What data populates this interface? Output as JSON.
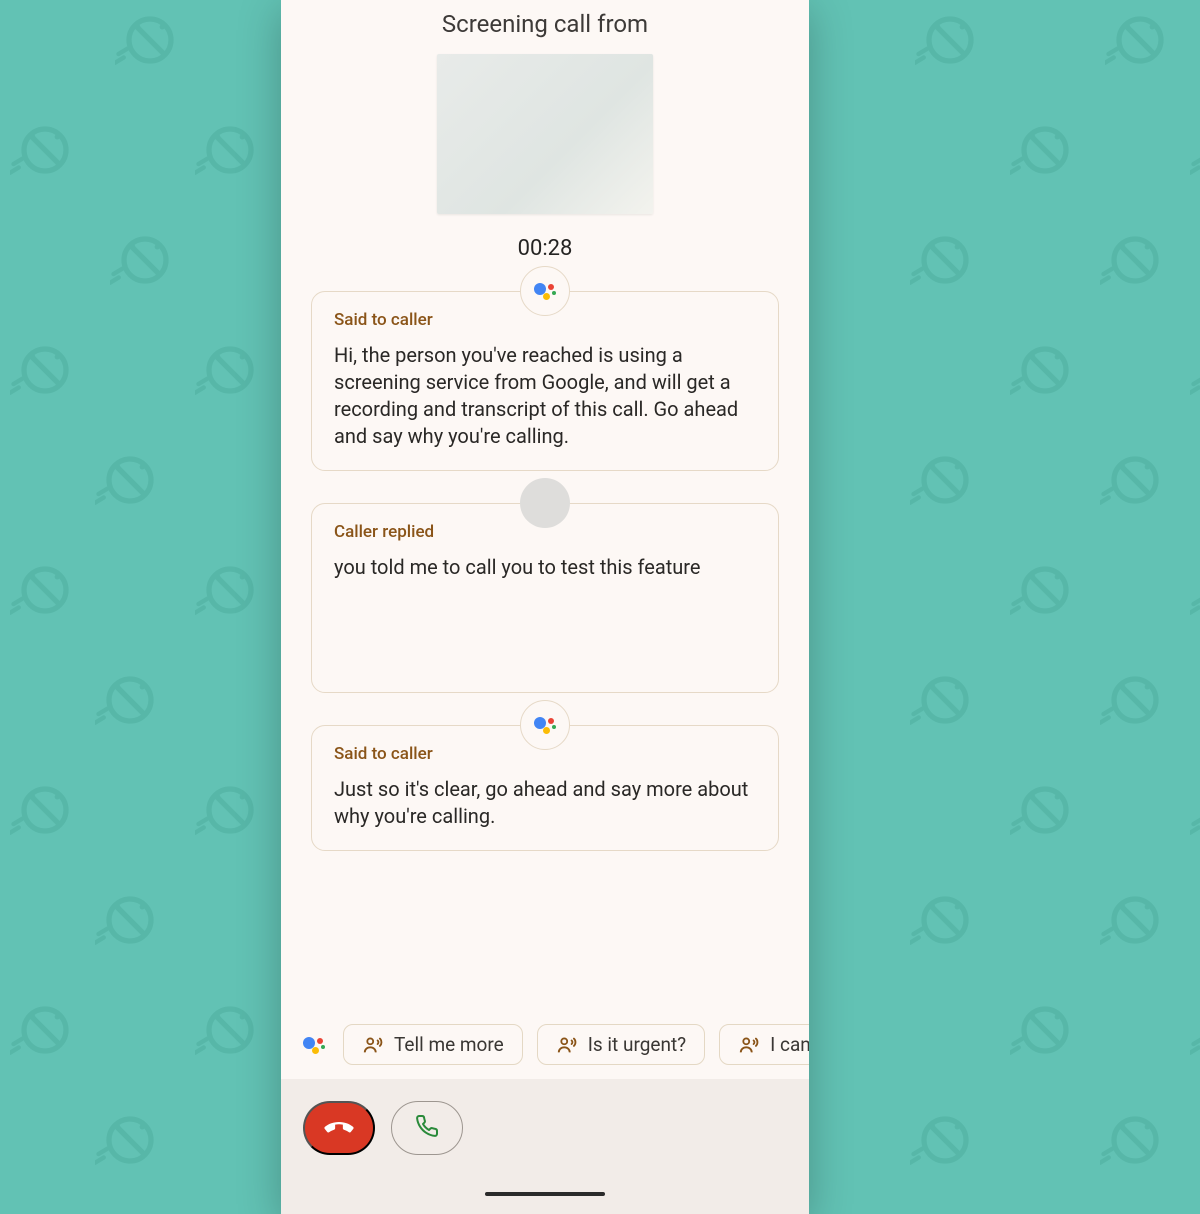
{
  "header": {
    "title": "Screening call from",
    "timer": "00:28"
  },
  "messages": [
    {
      "label": "Said to caller",
      "text": "Hi, the person you've reached is using a screening service from Google, and will get a recording and transcript of this call. Go ahead and say why you're calling."
    },
    {
      "label": "Caller replied",
      "text": "you told me to call you to test this feature"
    },
    {
      "label": "Said to caller",
      "text": "Just so it's clear, go ahead and say more about why you're calling."
    }
  ],
  "quick_replies": [
    {
      "label": "Tell me more"
    },
    {
      "label": "Is it urgent?"
    },
    {
      "label": "I can't"
    }
  ]
}
